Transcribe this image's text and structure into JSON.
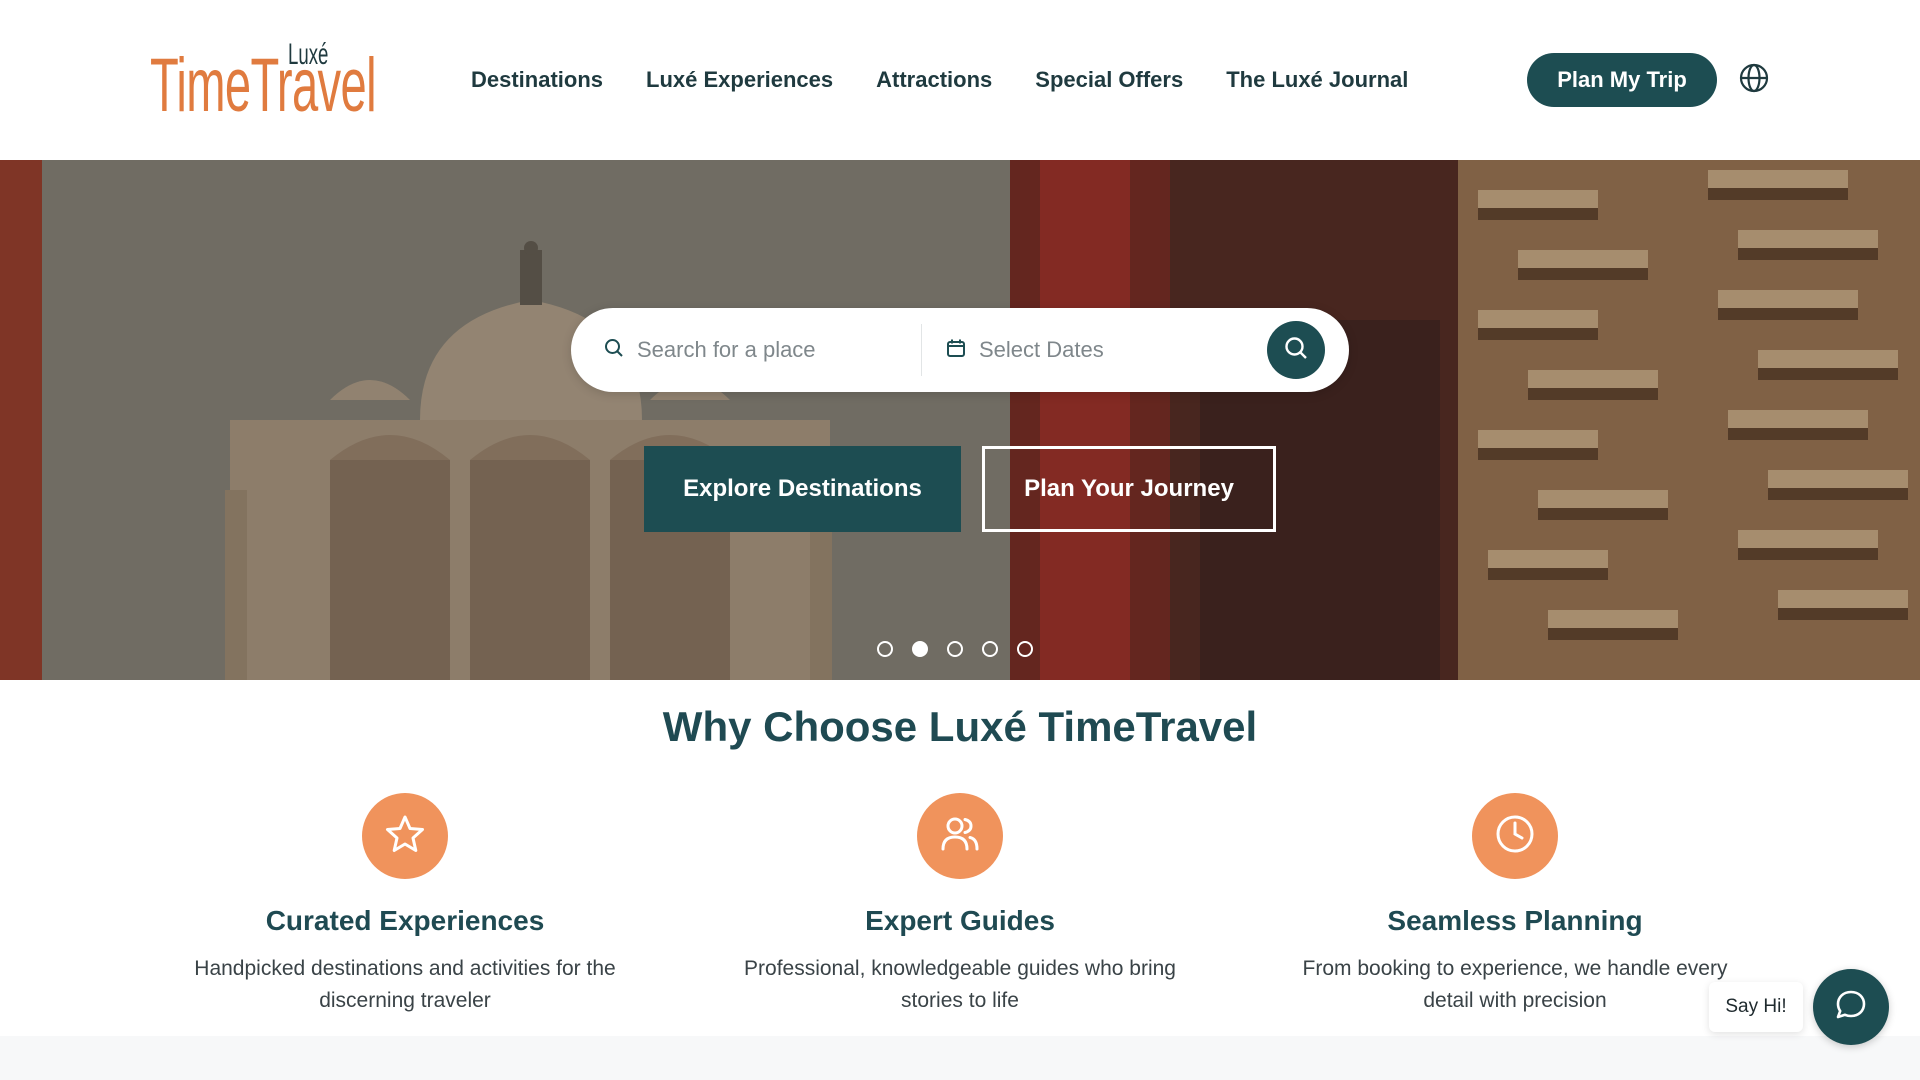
{
  "brand": {
    "logo_main": "TimeTravel",
    "logo_small": "Luxé"
  },
  "nav": {
    "items": [
      {
        "label": "Destinations"
      },
      {
        "label": "Luxé Experiences"
      },
      {
        "label": "Attractions"
      },
      {
        "label": "Special Offers"
      },
      {
        "label": "The Luxé Journal"
      }
    ]
  },
  "header": {
    "plan_button": "Plan My Trip",
    "globe_icon": "globe-icon"
  },
  "search": {
    "place_placeholder": "Search for a place",
    "dates_placeholder": "Select Dates",
    "place_icon": "search-icon",
    "dates_icon": "calendar-icon",
    "submit_icon": "search-icon"
  },
  "hero": {
    "cta_primary": "Explore Destinations",
    "cta_secondary": "Plan Your Journey",
    "slides_count": 5,
    "active_slide": 2
  },
  "why": {
    "title": "Why Choose Luxé TimeTravel",
    "features": [
      {
        "icon": "star-icon",
        "title": "Curated Experiences",
        "desc": "Handpicked destinations and activities for the discerning traveler"
      },
      {
        "icon": "users-icon",
        "title": "Expert Guides",
        "desc": "Professional, knowledgeable guides who bring stories to life"
      },
      {
        "icon": "clock-icon",
        "title": "Seamless Planning",
        "desc": "From booking to experience, we handle every detail with precision"
      }
    ]
  },
  "chat": {
    "greeting": "Say Hi!",
    "icon": "chat-icon"
  },
  "colors": {
    "brand_orange": "#e07b3f",
    "accent_teal": "#1d4d52",
    "icon_orange": "#f0935c",
    "heading": "#1f4a52"
  }
}
